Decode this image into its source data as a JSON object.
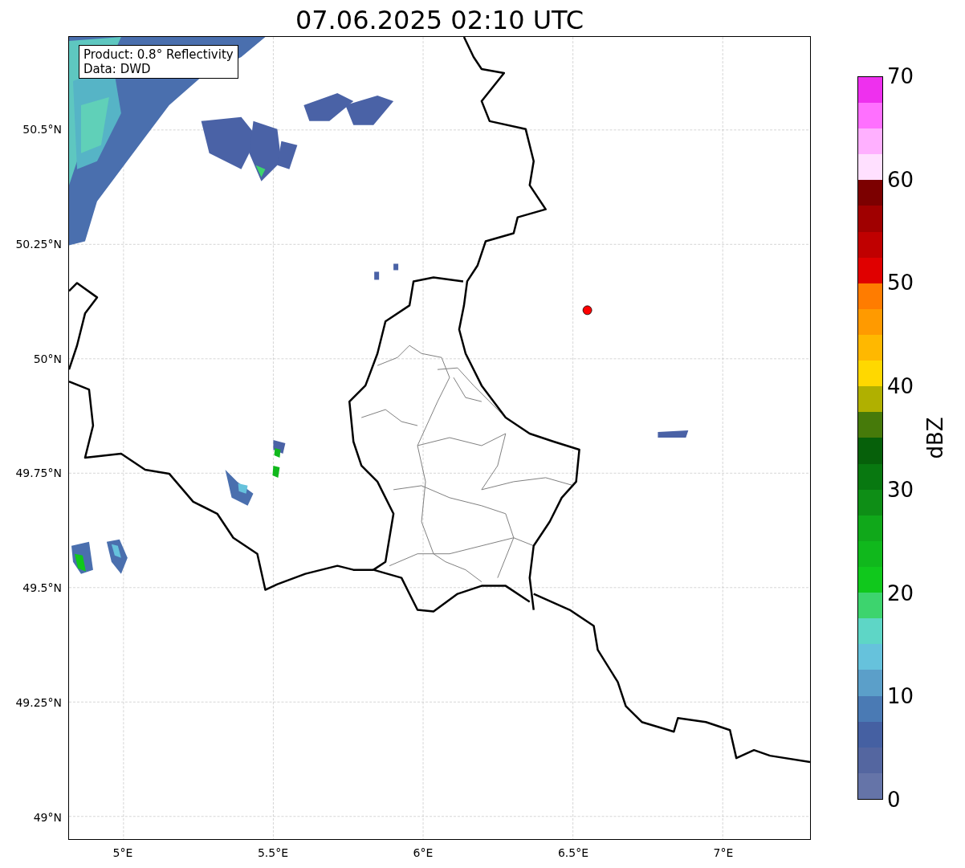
{
  "title": "07.06.2025 02:10 UTC",
  "map": {
    "info_lines": [
      "Product: 0.8° Reflectivity",
      "Data: DWD"
    ],
    "lat_ticks": [
      "50.5°N",
      "50.25°N",
      "50°N",
      "49.75°N",
      "49.5°N",
      "49.25°N",
      "49°N"
    ],
    "lon_ticks": [
      "5°E",
      "5.5°E",
      "6°E",
      "6.5°E",
      "7°E"
    ]
  },
  "colorbar": {
    "label": "dBZ",
    "ticks": [
      "70",
      "60",
      "50",
      "40",
      "30",
      "20",
      "10",
      "0"
    ],
    "segments": [
      {
        "color": "#6574a8"
      },
      {
        "color": "#5466a0"
      },
      {
        "color": "#4560a2"
      },
      {
        "color": "#4a7ab4"
      },
      {
        "color": "#5b9fc9"
      },
      {
        "color": "#66c2dc"
      },
      {
        "color": "#5ed6c6"
      },
      {
        "color": "#3dd46e"
      },
      {
        "color": "#10c81c"
      },
      {
        "color": "#10b81c"
      },
      {
        "color": "#10a81a"
      },
      {
        "color": "#0e8e16"
      },
      {
        "color": "#087810"
      },
      {
        "color": "#06600a"
      },
      {
        "color": "#467a0a"
      },
      {
        "color": "#b0b000"
      },
      {
        "color": "#ffd800"
      },
      {
        "color": "#ffb800"
      },
      {
        "color": "#ff9a00"
      },
      {
        "color": "#ff7c00"
      },
      {
        "color": "#e00000"
      },
      {
        "color": "#c00000"
      },
      {
        "color": "#a00000"
      },
      {
        "color": "#7c0000"
      },
      {
        "color": "#ffe0ff"
      },
      {
        "color": "#ffb0ff"
      },
      {
        "color": "#ff70ff"
      },
      {
        "color": "#ee30ee"
      }
    ]
  }
}
